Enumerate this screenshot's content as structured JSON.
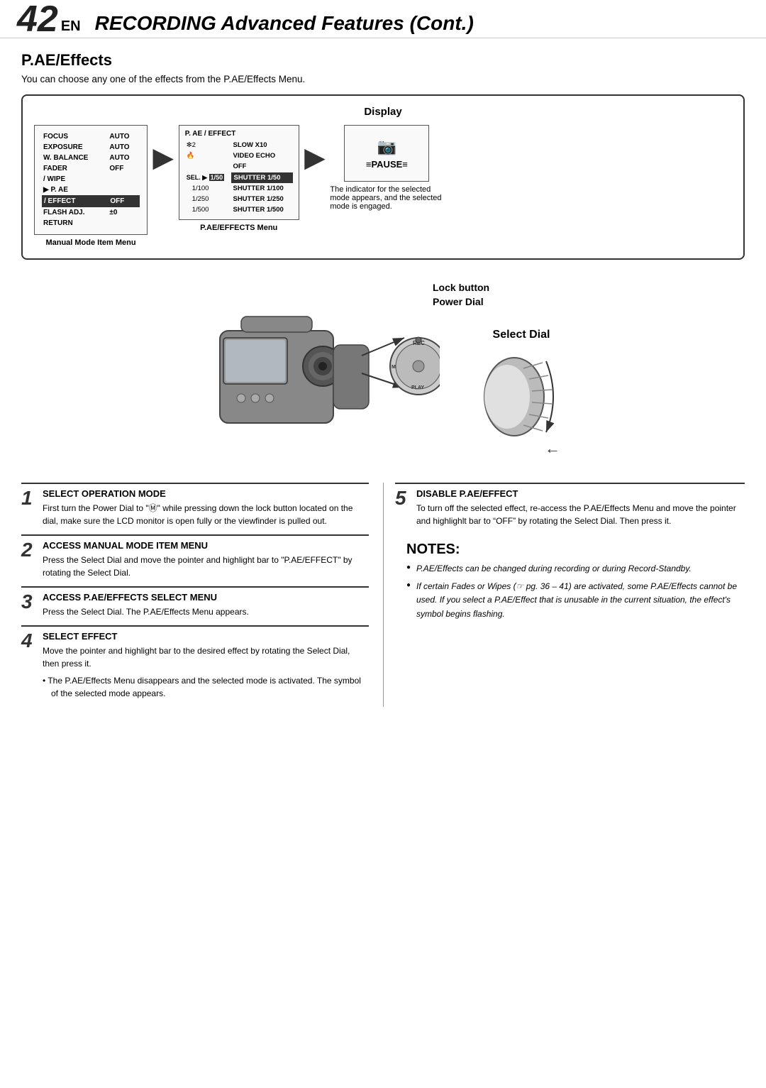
{
  "header": {
    "number": "42",
    "en": "EN",
    "title_italic": "RECORDING",
    "title_rest": " Advanced Features (Cont.)"
  },
  "section": {
    "title": "P.AE/Effects",
    "intro": "You can choose any one of the effects from the P.AE/Effects Menu."
  },
  "display_box": {
    "title": "Display",
    "manual_menu": {
      "label": "Manual Mode Item Menu",
      "rows": [
        {
          "col1": "FOCUS",
          "col2": "AUTO"
        },
        {
          "col1": "EXPOSURE",
          "col2": "AUTO"
        },
        {
          "col1": "W. BALANCE",
          "col2": "AUTO"
        },
        {
          "col1": "FADER",
          "col2": "OFF"
        },
        {
          "col1": "/ WIPE",
          "col2": ""
        },
        {
          "col1": "▶ P. AE",
          "col2": ""
        },
        {
          "col1": "/ EFFECT",
          "col2": "OFF"
        },
        {
          "col1": "FLASH ADJ.",
          "col2": "±0"
        },
        {
          "col1": "",
          "col2": ""
        },
        {
          "col1": "RETURN",
          "col2": ""
        }
      ]
    },
    "pae_menu": {
      "title": "P. AE / EFFECT",
      "label": "P.AE/EFFECTS Menu",
      "rows": [
        {
          "col1": "✻2",
          "col2": "SLOW X10"
        },
        {
          "col1": "🔥",
          "col2": "VIDEO ECHO"
        },
        {
          "col1": "",
          "col2": "OFF"
        },
        {
          "col1": "SEL. ▶ 1/50",
          "col2": "SHUTTER 1/50",
          "highlight": true
        },
        {
          "col1": "1/100",
          "col2": "SHUTTER 1/100"
        },
        {
          "col1": "1/250",
          "col2": "SHUTTER 1/250"
        },
        {
          "col1": "1/500",
          "col2": "SHUTTER 1/500"
        }
      ]
    },
    "pause_panel": {
      "cam_icon": "📷",
      "pause_text": "≡PAUSE≡"
    },
    "indicator_text": "The indicator for the selected mode appears, and the selected mode is engaged."
  },
  "diagram": {
    "lock_button_label": "Lock button",
    "power_dial_label": "Power Dial",
    "select_dial_label": "Select Dial"
  },
  "steps": [
    {
      "number": "1",
      "heading": "SELECT OPERATION MODE",
      "body": "First turn the Power Dial to \"Ⓜ\" while pressing down the lock button located on the dial, make sure the LCD monitor is open fully or the viewfinder is pulled out."
    },
    {
      "number": "2",
      "heading": "ACCESS MANUAL MODE ITEM MENU",
      "body": "Press the Select Dial and move the pointer and highlight bar to \"P.AE/EFFECT\" by rotating the Select Dial."
    },
    {
      "number": "3",
      "heading": "ACCESS P.AE/EFFECTS SELECT MENU",
      "body": "Press the Select Dial. The P.AE/Effects Menu appears."
    },
    {
      "number": "4",
      "heading": "SELECT EFFECT",
      "body": "Move the pointer and highlight bar to the desired effect by rotating the Select Dial, then press it.",
      "bullet": "The P.AE/Effects Menu disappears and the selected mode is activated. The symbol of the selected mode appears."
    },
    {
      "number": "5",
      "heading": "DISABLE P.AE/EFFECT",
      "body": "To turn off the selected effect, re-access the P.AE/Effects Menu and move the pointer and highlighlt bar to “OFF” by rotating the Select Dial. Then press it."
    }
  ],
  "notes": {
    "title": "NOTES:",
    "items": [
      "P.AE/Effects can be changed during recording or during Record-Standby.",
      "If certain Fades or Wipes (☞ pg. 36 – 41) are activated, some P.AE/Effects cannot be used. If you select a P.AE/Effect that is unusable in the current situation, the effect's symbol begins flashing."
    ]
  }
}
